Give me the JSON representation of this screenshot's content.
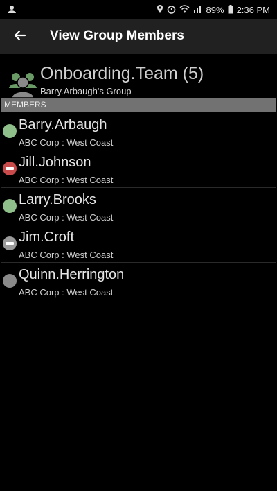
{
  "status_bar": {
    "battery": "89%",
    "time": "2:36 PM"
  },
  "app_bar": {
    "title": "View Group Members"
  },
  "group": {
    "name": "Onboarding.Team (5)",
    "owner": "Barry.Arbaugh's Group"
  },
  "section": {
    "label": "MEMBERS"
  },
  "colors": {
    "online": "#8fbf8a",
    "busy": "#c84a4a",
    "away": "#9a9a9a",
    "offline": "#8a8a8a"
  },
  "members": [
    {
      "name": "Barry.Arbaugh",
      "org": "ABC Corp : West Coast",
      "status": "online-icon"
    },
    {
      "name": "Jill.Johnson",
      "org": "ABC Corp : West Coast",
      "status": "busy-icon"
    },
    {
      "name": "Larry.Brooks",
      "org": "ABC Corp : West Coast",
      "status": "online-icon"
    },
    {
      "name": "Jim.Croft",
      "org": "ABC Corp : West Coast",
      "status": "away-icon"
    },
    {
      "name": "Quinn.Herrington",
      "org": "ABC Corp : West Coast",
      "status": "offline-icon"
    }
  ]
}
